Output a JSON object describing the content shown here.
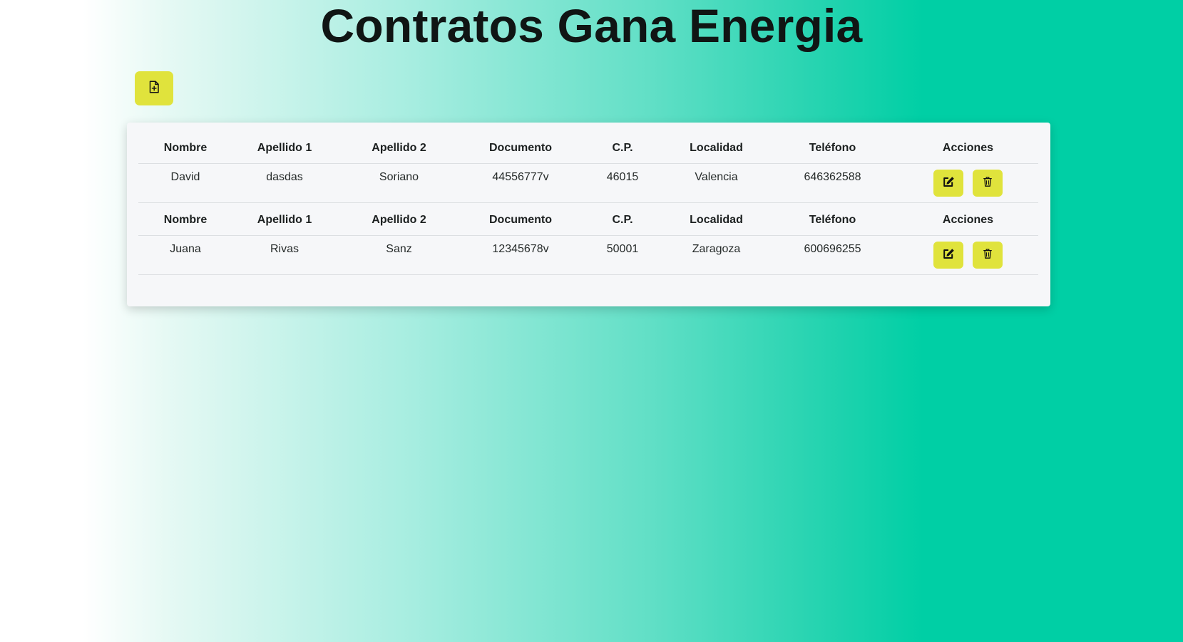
{
  "title": "Contratos Gana Energia",
  "new_button_icon": "file-plus-icon",
  "accent_color": "#e0e33c",
  "columns": [
    "Nombre",
    "Apellido 1",
    "Apellido 2",
    "Documento",
    "C.P.",
    "Localidad",
    "Teléfono",
    "Acciones"
  ],
  "records": [
    {
      "nombre": "David",
      "apellido1": "dasdas",
      "apellido2": "Soriano",
      "documento": "44556777v",
      "cp": "46015",
      "localidad": "Valencia",
      "telefono": "646362588",
      "actions": [
        "edit-icon",
        "trash-icon"
      ]
    },
    {
      "nombre": "Juana",
      "apellido1": "Rivas",
      "apellido2": "Sanz",
      "documento": "12345678v",
      "cp": "50001",
      "localidad": "Zaragoza",
      "telefono": "600696255",
      "actions": [
        "edit-icon",
        "trash-icon"
      ]
    }
  ]
}
